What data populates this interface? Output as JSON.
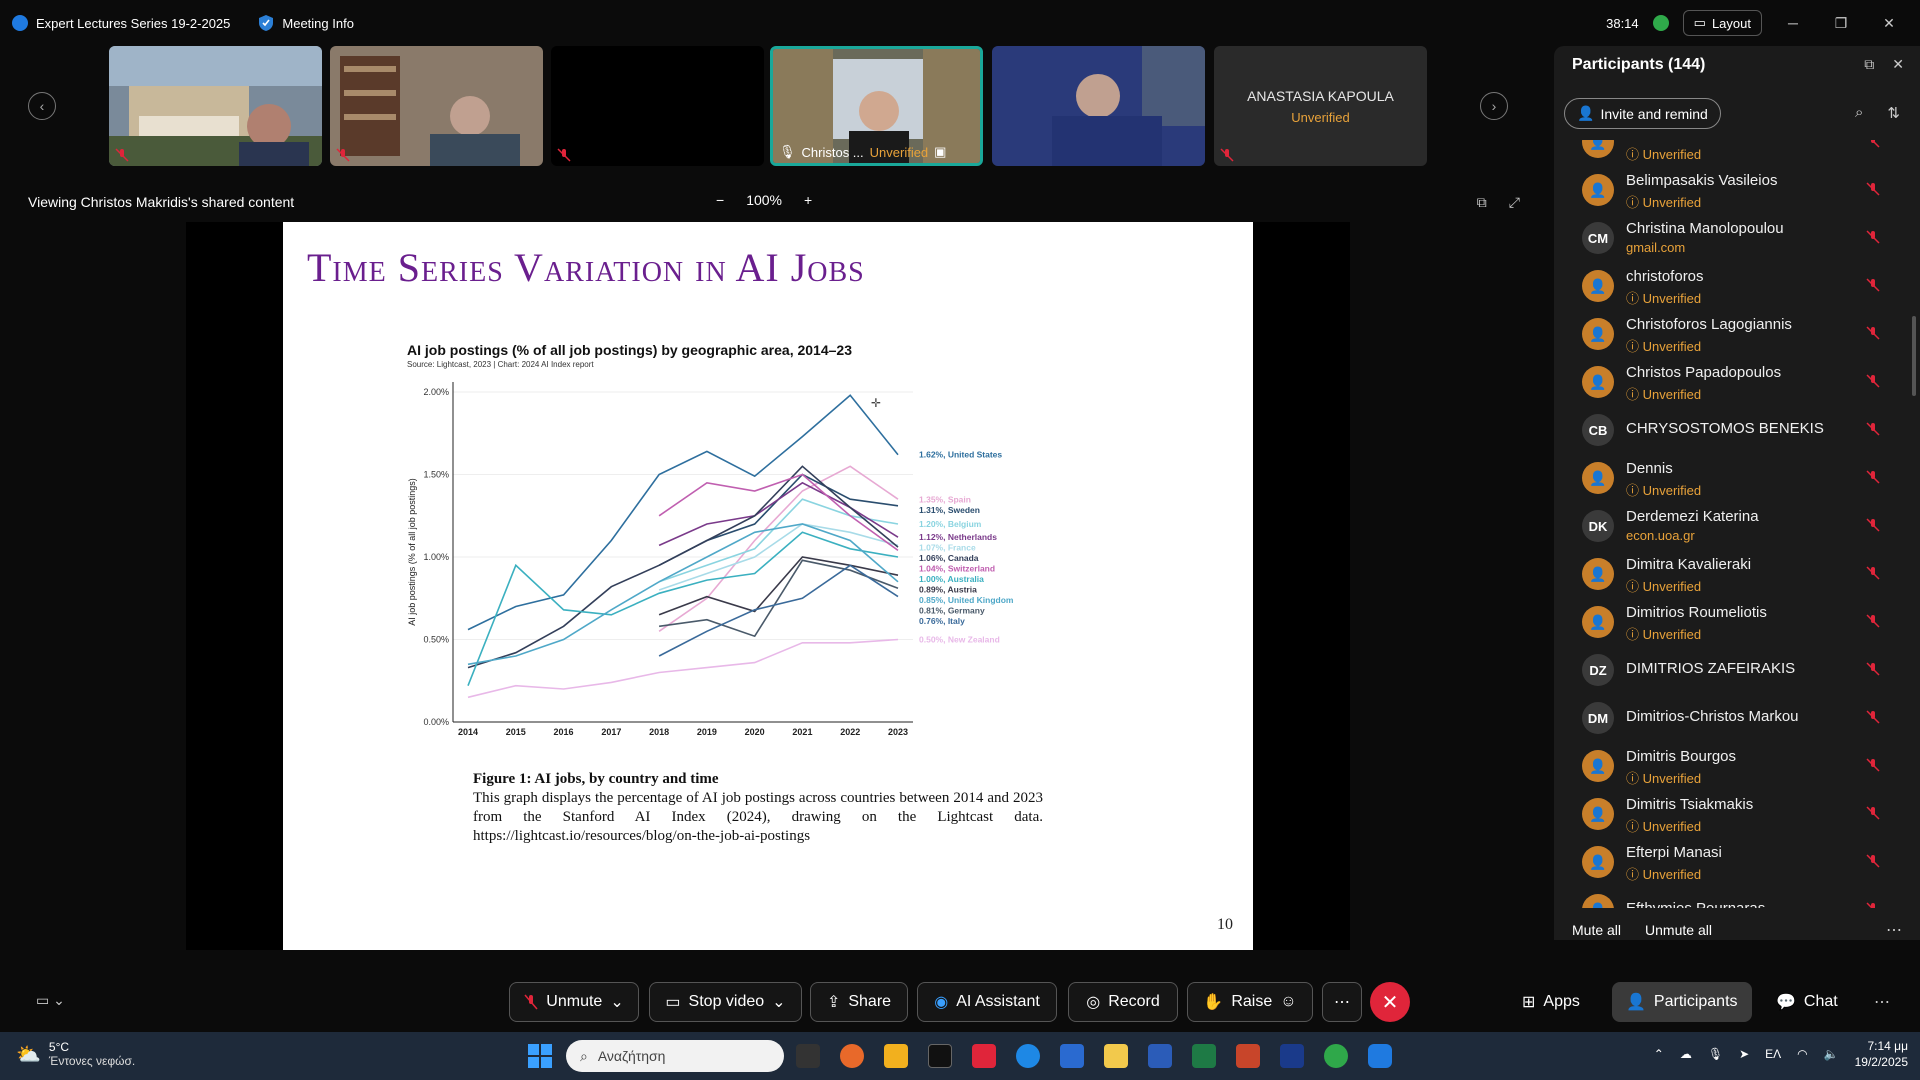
{
  "titlebar": {
    "app_title": "Expert Lectures Series 19-2-2025",
    "meeting_info": "Meeting Info",
    "timer": "38:14",
    "layout_label": "Layout"
  },
  "tiles": [
    {
      "name": "",
      "status": ""
    },
    {
      "name": "",
      "status": ""
    },
    {
      "name": "",
      "status": ""
    },
    {
      "name": "Christos ...",
      "status": "Unverified"
    },
    {
      "name": "",
      "status": ""
    },
    {
      "name": "ANASTASIA KAPOULA",
      "status": "Unverified"
    }
  ],
  "shared": {
    "text": "Viewing Christos Makridis's shared content",
    "zoom": "100%",
    "zoom_out": "−",
    "zoom_in": "+"
  },
  "slide": {
    "title": "Time Series Variation in AI Jobs",
    "chart_title": "AI job postings (% of all job postings) by geographic area, 2014–23",
    "chart_source": "Source: Lightcast, 2023 | Chart: 2024 AI Index report",
    "fig_caption": "Figure 1: AI jobs, by country and time",
    "fig_text": "This graph displays the percentage of AI job postings across countries between 2014 and 2023 from the Stanford AI Index (2024), drawing on the Lightcast data. https://lightcast.io/resources/blog/on-the-job-ai-postings",
    "page_number": "10"
  },
  "chart_data": {
    "type": "line",
    "title": "AI job postings (% of all job postings) by geographic area, 2014–23",
    "subtitle": "Source: Lightcast, 2023 | Chart: 2024 AI Index report",
    "xlabel": "",
    "ylabel": "AI job postings (% of all job postings)",
    "x": [
      2014,
      2015,
      2016,
      2017,
      2018,
      2019,
      2020,
      2021,
      2022,
      2023
    ],
    "ylim": [
      0,
      2.0
    ],
    "yticks": [
      "0.00%",
      "0.50%",
      "1.00%",
      "1.50%",
      "2.00%"
    ],
    "series": [
      {
        "name": "United States",
        "end_label": "1.62%, United States",
        "color": "#2e6f9e",
        "values": [
          0.56,
          0.7,
          0.77,
          1.1,
          1.5,
          1.64,
          1.49,
          1.73,
          1.98,
          1.62
        ]
      },
      {
        "name": "Spain",
        "end_label": "1.35%, Spain",
        "color": "#e7a9d3",
        "values": [
          null,
          null,
          null,
          null,
          0.55,
          0.75,
          1.1,
          1.4,
          1.55,
          1.35
        ]
      },
      {
        "name": "Sweden",
        "end_label": "1.31%, Sweden",
        "color": "#2a4d6e",
        "values": [
          null,
          null,
          null,
          null,
          0.95,
          1.1,
          1.2,
          1.5,
          1.35,
          1.31
        ]
      },
      {
        "name": "Belgium",
        "end_label": "1.20%, Belgium",
        "color": "#8ad4e0",
        "values": [
          null,
          null,
          null,
          null,
          0.85,
          0.95,
          1.05,
          1.35,
          1.25,
          1.2
        ]
      },
      {
        "name": "Netherlands",
        "end_label": "1.12%, Netherlands",
        "color": "#7a3a8a",
        "values": [
          null,
          null,
          null,
          null,
          1.07,
          1.2,
          1.25,
          1.45,
          1.3,
          1.12
        ]
      },
      {
        "name": "France",
        "end_label": "1.07%, France",
        "color": "#a8dbe8",
        "values": [
          null,
          null,
          null,
          null,
          0.8,
          0.9,
          1.0,
          1.2,
          1.15,
          1.07
        ]
      },
      {
        "name": "Canada",
        "end_label": "1.06%, Canada",
        "color": "#333f5a",
        "values": [
          0.33,
          0.42,
          0.58,
          0.82,
          0.95,
          1.1,
          1.25,
          1.55,
          1.3,
          1.06
        ]
      },
      {
        "name": "Switzerland",
        "end_label": "1.04%, Switzerland",
        "color": "#c05fb0",
        "values": [
          null,
          null,
          null,
          null,
          1.25,
          1.45,
          1.4,
          1.5,
          1.25,
          1.04
        ]
      },
      {
        "name": "Australia",
        "end_label": "1.00%, Australia",
        "color": "#3bb0c0",
        "values": [
          0.22,
          0.95,
          0.68,
          0.65,
          0.78,
          0.86,
          0.9,
          1.15,
          1.05,
          1.0
        ]
      },
      {
        "name": "Austria",
        "end_label": "0.89%, Austria",
        "color": "#3a3a4a",
        "values": [
          null,
          null,
          null,
          null,
          0.65,
          0.76,
          0.67,
          1.0,
          0.95,
          0.89
        ]
      },
      {
        "name": "United Kingdom",
        "end_label": "0.85%, United Kingdom",
        "color": "#4fa8c8",
        "values": [
          0.35,
          0.4,
          0.5,
          0.68,
          0.85,
          1.0,
          1.15,
          1.2,
          1.1,
          0.85
        ]
      },
      {
        "name": "Germany",
        "end_label": "0.81%, Germany",
        "color": "#4a5a6a",
        "values": [
          null,
          null,
          null,
          null,
          0.58,
          0.62,
          0.52,
          0.98,
          0.92,
          0.81
        ]
      },
      {
        "name": "Italy",
        "end_label": "0.76%, Italy",
        "color": "#3a6a9a",
        "values": [
          null,
          null,
          null,
          null,
          0.4,
          0.55,
          0.68,
          0.75,
          0.95,
          0.76
        ]
      },
      {
        "name": "New Zealand",
        "end_label": "0.50%, New Zealand",
        "color": "#e8b8e8",
        "values": [
          0.15,
          0.22,
          0.2,
          0.24,
          0.3,
          0.33,
          0.36,
          0.48,
          0.48,
          0.5
        ]
      }
    ]
  },
  "panel": {
    "title": "Participants (144)",
    "invite": "Invite and remind",
    "mute_all": "Mute all",
    "unmute_all": "Unmute all",
    "participants": [
      {
        "name": "",
        "sub": "Unverified",
        "initials": "",
        "sub_color": "#e8a23a"
      },
      {
        "name": "Belimpasakis Vasileios",
        "sub": "Unverified",
        "initials": "",
        "sub_color": "#e8a23a"
      },
      {
        "name": "Christina Manolopoulou",
        "sub": "gmail.com",
        "initials": "CM",
        "sub_color": "#e8a23a"
      },
      {
        "name": "christoforos",
        "sub": "Unverified",
        "initials": "",
        "sub_color": "#e8a23a"
      },
      {
        "name": "Christoforos Lagogiannis",
        "sub": "Unverified",
        "initials": "",
        "sub_color": "#e8a23a"
      },
      {
        "name": "Christos Papadopoulos",
        "sub": "Unverified",
        "initials": "",
        "sub_color": "#e8a23a"
      },
      {
        "name": "CHRYSOSTOMOS BENEKIS",
        "sub": "",
        "initials": "CB",
        "sub_color": "#e8a23a"
      },
      {
        "name": "Dennis",
        "sub": "Unverified",
        "initials": "",
        "sub_color": "#e8a23a"
      },
      {
        "name": "Derdemezi Katerina",
        "sub": "econ.uoa.gr",
        "initials": "DK",
        "sub_color": "#e8a23a"
      },
      {
        "name": "Dimitra Kavalieraki",
        "sub": "Unverified",
        "initials": "",
        "sub_color": "#e8a23a"
      },
      {
        "name": "Dimitrios Roumeliotis",
        "sub": "Unverified",
        "initials": "",
        "sub_color": "#e8a23a"
      },
      {
        "name": "DIMITRIOS ZAFEIRAKIS",
        "sub": "",
        "initials": "DZ",
        "sub_color": "#e8a23a"
      },
      {
        "name": "Dimitrios-Christos Markou",
        "sub": "",
        "initials": "DM",
        "sub_color": "#e8a23a"
      },
      {
        "name": "Dimitris Bourgos",
        "sub": "Unverified",
        "initials": "",
        "sub_color": "#e8a23a"
      },
      {
        "name": "Dimitris Tsiakmakis",
        "sub": "Unverified",
        "initials": "",
        "sub_color": "#e8a23a"
      },
      {
        "name": "Efterpi Manasi",
        "sub": "Unverified",
        "initials": "",
        "sub_color": "#e8a23a"
      },
      {
        "name": "Efthymios Pournaras",
        "sub": "",
        "initials": "",
        "sub_color": "#e8a23a"
      }
    ]
  },
  "toolbar": {
    "unmute": "Unmute",
    "stop_video": "Stop video",
    "share": "Share",
    "ai_assistant": "AI Assistant",
    "record": "Record",
    "raise": "Raise",
    "apps": "Apps",
    "participants": "Participants",
    "chat": "Chat"
  },
  "taskbar": {
    "temp": "5°C",
    "weather": "Έντονες νεφώσ.",
    "search_placeholder": "Αναζήτηση",
    "lang": "ΕΛ",
    "time": "7:14 μμ",
    "date": "19/2/2025"
  }
}
